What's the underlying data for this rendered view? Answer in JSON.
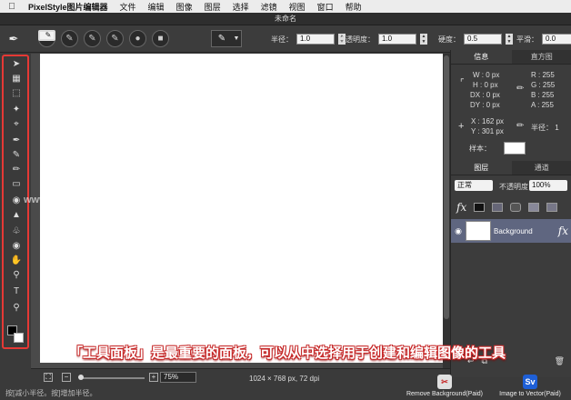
{
  "menubar": {
    "app_name": "PixelStyle图片编辑器",
    "items": [
      "文件",
      "编辑",
      "图像",
      "图层",
      "选择",
      "滤镜",
      "视图",
      "窗口",
      "帮助"
    ]
  },
  "window": {
    "title": "未命名"
  },
  "options": {
    "radius_label": "半径：",
    "radius_value": "1.0",
    "opacity_label": "不透明度：",
    "opacity_value": "1.0",
    "hardness_label": "硬度：",
    "hardness_value": "0.5",
    "smooth_label": "平滑：",
    "smooth_value": "0.0"
  },
  "info_panel": {
    "tab_info": "信息",
    "tab_histogram": "直方图",
    "w": "W :  0 px",
    "h": "H :  0 px",
    "dx": "DX :  0 px",
    "dy": "DY :  0 px",
    "r": "R :   255",
    "g": "G :   255",
    "b": "B :   255",
    "a": "A :   255",
    "x": "X :  162 px",
    "y": "Y :  301 px",
    "radius": "半径：  1",
    "sample_label": "样本："
  },
  "layers_panel": {
    "tab_layers": "图层",
    "tab_channels": "通道",
    "blend_mode": "正常",
    "opacity_label": "不透明度",
    "opacity_value": "100%",
    "layer_name": "Background"
  },
  "status": {
    "zoom": "75%",
    "doc_info": "1024 × 768 px, 72 dpi",
    "hint": "按[减小半径。按]增加半径。"
  },
  "promos": {
    "remove_bg": "Remove Background(Paid)",
    "to_vector": "Image to Vector(Paid)"
  },
  "overlay": {
    "caption": "「工具面板」是最重要的面板，可以从中选择用于创建和编辑图像的工具",
    "watermark": "www.MacZ.com"
  },
  "colors": {
    "highlight": "#e53935",
    "layer_selected": "#5f6680"
  }
}
